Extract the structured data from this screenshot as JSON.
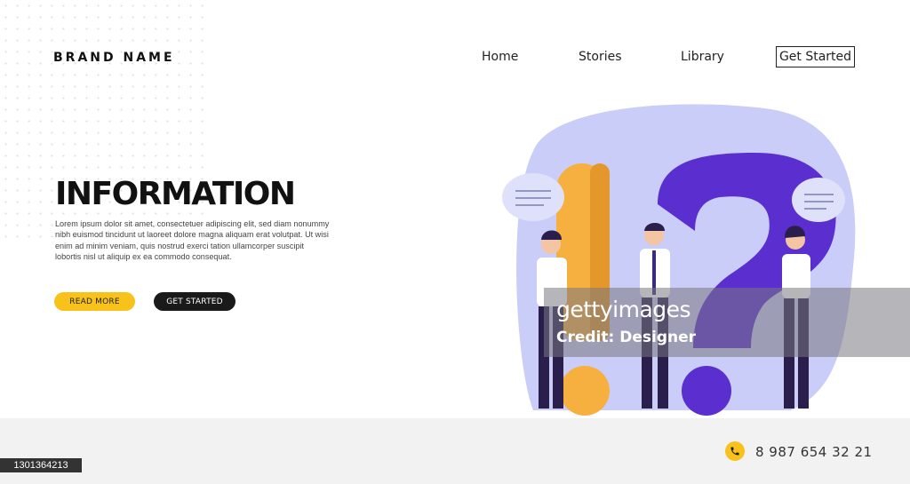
{
  "header": {
    "brand": "BRAND NAME",
    "nav": [
      "Home",
      "Stories",
      "Library"
    ],
    "cta": "Get Started"
  },
  "hero": {
    "title": "INFORMATION",
    "body": "Lorem ipsum dolor sit amet, consectetuer adipiscing elit, sed diam nonummy nibh euismod tincidunt ut laoreet dolore magna aliquam erat volutpat. Ut wisi enim ad minim veniam, quis nostrud exerci tation ullamcorper suscipit lobortis nisl ut aliquip ex ea commodo consequat.",
    "read_more": "READ MORE",
    "get_started": "GET STARTED"
  },
  "footer": {
    "phone": "8 987 654 32 21",
    "phone_icon": "phone-icon"
  },
  "overlay": {
    "logo": "gettyimages",
    "credit": "Credit: Designer",
    "image_id": "1301364213"
  },
  "colors": {
    "accent_yellow": "#f8c21b",
    "blob": "#c9cdf7",
    "purple": "#5b2ed0",
    "orange": "#f6b040",
    "dark": "#1a1a1a"
  }
}
